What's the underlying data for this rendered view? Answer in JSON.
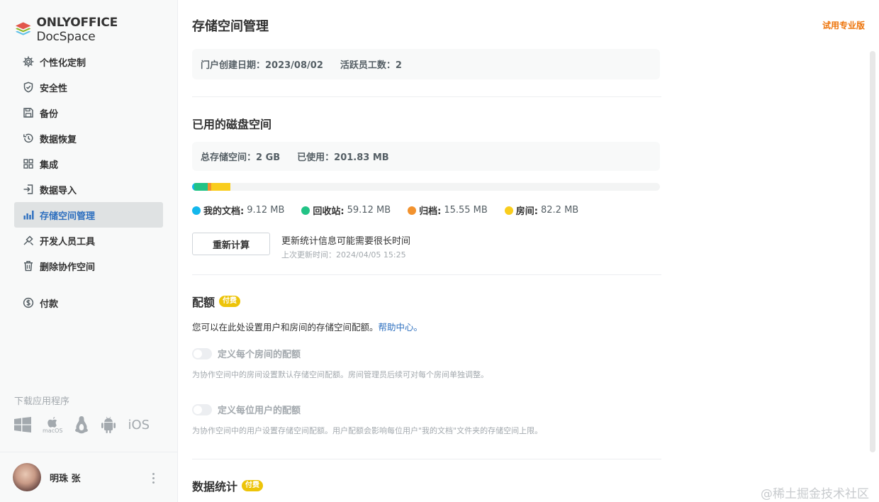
{
  "app": {
    "logo_brand": "ONLYOFFICE",
    "logo_product": "DocSpace"
  },
  "sidebar": {
    "items": [
      {
        "label": "个性化定制",
        "icon": "gear-icon"
      },
      {
        "label": "安全性",
        "icon": "shield-icon"
      },
      {
        "label": "备份",
        "icon": "save-icon"
      },
      {
        "label": "数据恢复",
        "icon": "restore-icon"
      },
      {
        "label": "集成",
        "icon": "grid-icon"
      },
      {
        "label": "数据导入",
        "icon": "import-icon"
      },
      {
        "label": "存储空间管理",
        "icon": "bar-chart-icon",
        "active": true
      },
      {
        "label": "开发人员工具",
        "icon": "developer-tools-icon"
      },
      {
        "label": "删除协作空间",
        "icon": "trash-icon"
      },
      {
        "label": "付款",
        "icon": "dollar-icon"
      }
    ],
    "download_title": "下载应用程序",
    "macos_label": "macOS",
    "ios_label": "iOS"
  },
  "profile": {
    "name": "明珠 张"
  },
  "header": {
    "title": "存储空间管理",
    "trial_link": "试用专业版"
  },
  "portal_info": {
    "created": "门户创建日期：2023/08/02",
    "active_users": "活跃员工数：2"
  },
  "disk": {
    "title": "已用的磁盘空间",
    "total": "总存储空间：2 GB",
    "used": "已使用：201.83 MB",
    "total_mb": 2048,
    "segments": [
      {
        "label": "我的文档",
        "value": "9.12 MB",
        "mb": 9.12,
        "color": "#13b7ec"
      },
      {
        "label": "回收站",
        "value": "59.12 MB",
        "mb": 59.12,
        "color": "#22c386"
      },
      {
        "label": "归档",
        "value": "15.55 MB",
        "mb": 15.55,
        "color": "#f2922e"
      },
      {
        "label": "房间",
        "value": "82.2 MB",
        "mb": 82.2,
        "color": "#f9cd1d"
      }
    ],
    "recalc_button": "重新计算",
    "recalc_note": "更新统计信息可能需要很长时间",
    "last_update": "上次更新时间：2024/04/05 15:25"
  },
  "quota": {
    "title": "配额",
    "badge": "付费",
    "desc": "您可以在此处设置用户和房间的存储空间配额。",
    "help_link": "帮助中心。",
    "rooms_label": "定义每个房间的配额",
    "rooms_desc": "为协作空间中的房间设置默认存储空间配额。房间管理员后续可对每个房间单独调整。",
    "users_label": "定义每位用户的配额",
    "users_desc": "为协作空间中的用户设置存储空间配额。用户配额会影响每位用户\"我的文档\"文件夹的存储空间上限。"
  },
  "stats": {
    "title": "数据统计",
    "badge": "付费"
  },
  "watermark": "@稀土掘金技术社区"
}
